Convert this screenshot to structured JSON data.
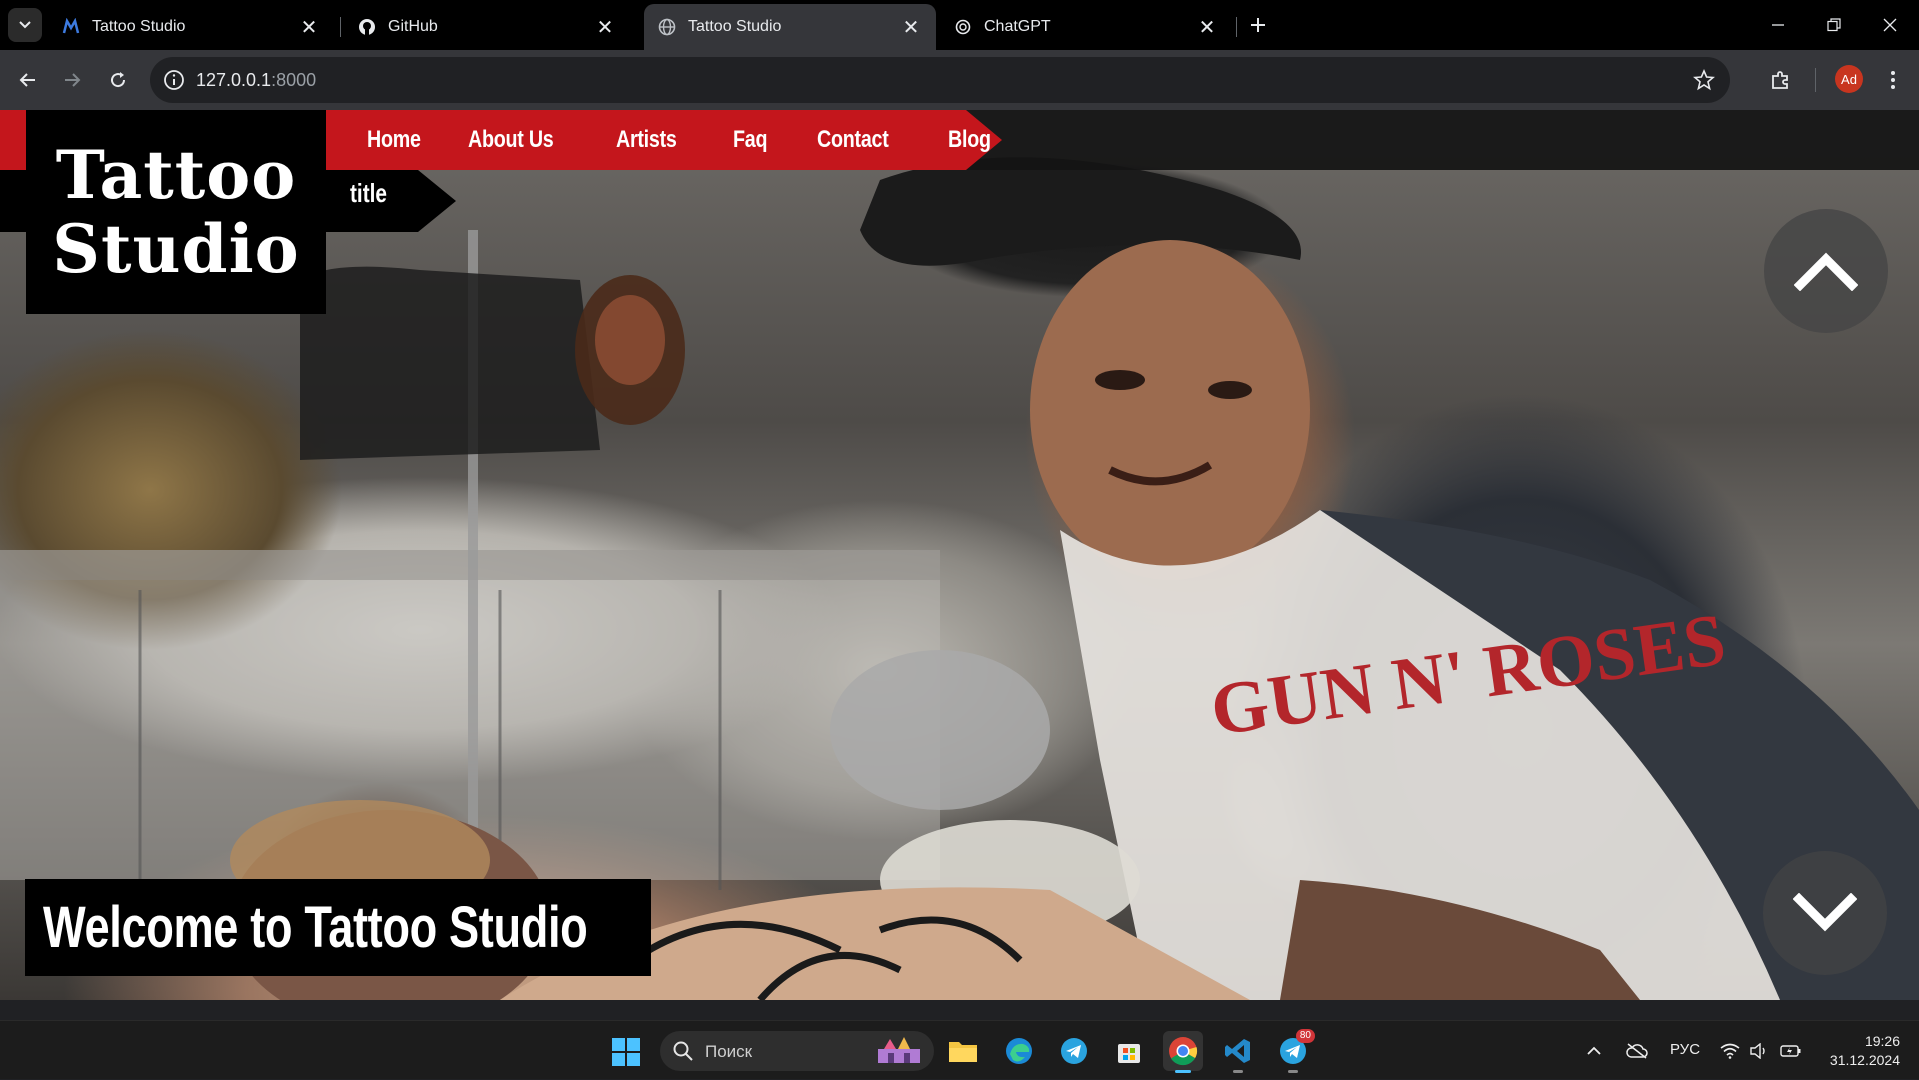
{
  "browser": {
    "tabs": [
      {
        "title": "Tattoo Studio",
        "icon": "tattoo-favicon",
        "active": false
      },
      {
        "title": "GitHub",
        "icon": "github-icon",
        "active": false
      },
      {
        "title": "Tattoo Studio",
        "icon": "globe-icon",
        "active": true
      },
      {
        "title": "ChatGPT",
        "icon": "chatgpt-icon",
        "active": false
      }
    ],
    "url_host": "127.0.0.1",
    "url_port": ":8000",
    "profile_initials": "Ad"
  },
  "site": {
    "logo_line1": "Tattoo",
    "logo_line2": "Studio",
    "menu": [
      "Home",
      "About Us",
      "Artists",
      "Faq",
      "Contact",
      "Blog"
    ],
    "sub_tab_label": "title",
    "welcome_text": "Welcome to Tattoo Studio"
  },
  "taskbar": {
    "search_placeholder": "Поиск",
    "telegram_badge": "80",
    "language": "РУС",
    "time": "19:26",
    "date": "31.12.2024"
  },
  "colors": {
    "nav_red": "#c4161c",
    "browser_bg": "#35363a",
    "tab_strip": "#000000"
  }
}
